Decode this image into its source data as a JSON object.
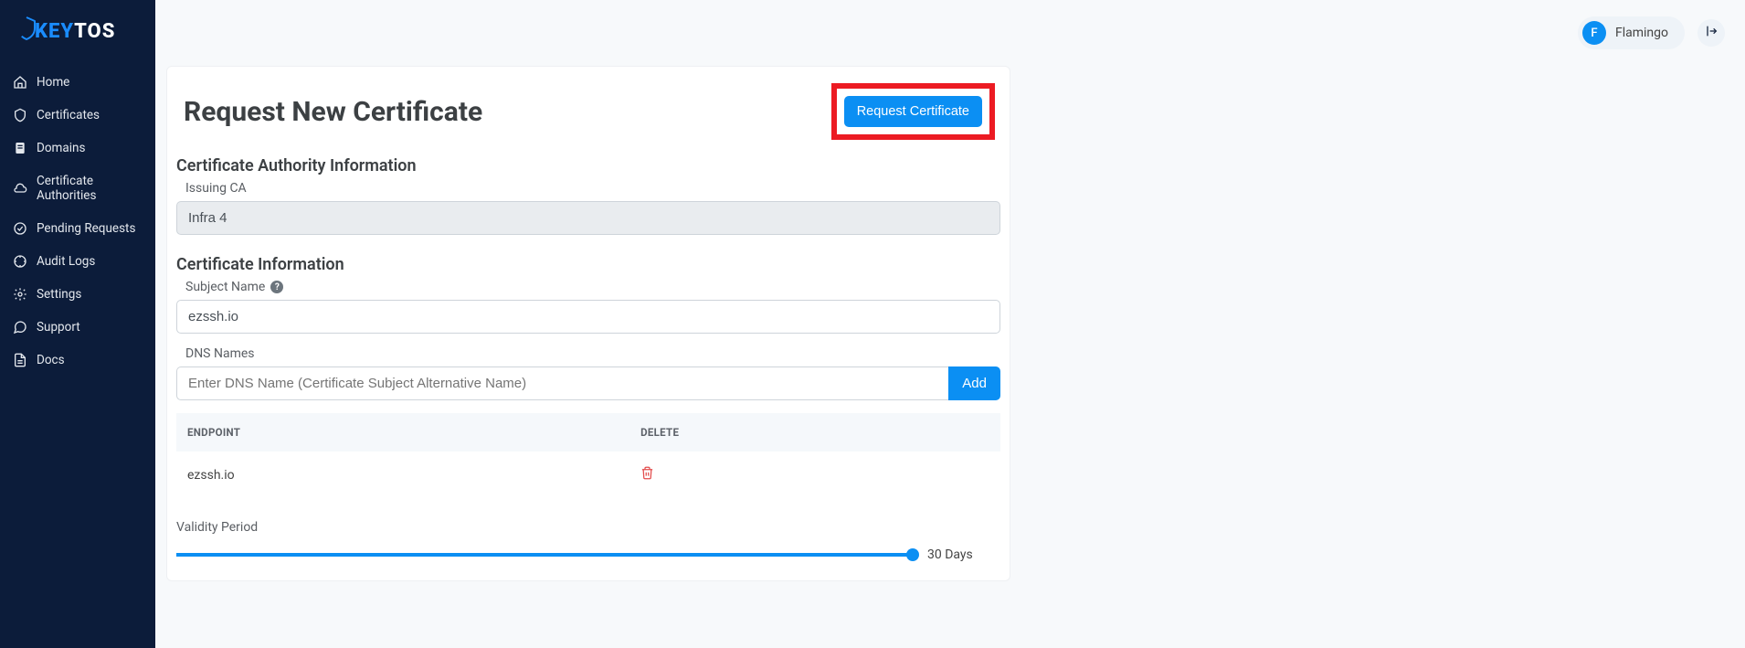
{
  "brand": {
    "text1": "KEY",
    "text2": "TOS"
  },
  "sidebar": {
    "items": [
      {
        "label": "Home",
        "icon": "home"
      },
      {
        "label": "Certificates",
        "icon": "shield"
      },
      {
        "label": "Domains",
        "icon": "doc"
      },
      {
        "label": "Certificate Authorities",
        "icon": "cloud"
      },
      {
        "label": "Pending Requests",
        "icon": "clock"
      },
      {
        "label": "Audit Logs",
        "icon": "target"
      },
      {
        "label": "Settings",
        "icon": "gear"
      },
      {
        "label": "Support",
        "icon": "chat"
      },
      {
        "label": "Docs",
        "icon": "page"
      }
    ]
  },
  "topbar": {
    "user_initial": "F",
    "user_name": "Flamingo"
  },
  "page": {
    "title": "Request New Certificate",
    "request_btn": "Request Certificate"
  },
  "ca_section": {
    "title": "Certificate Authority Information",
    "issuing_ca_label": "Issuing CA",
    "issuing_ca_value": "Infra 4"
  },
  "cert_section": {
    "title": "Certificate Information",
    "subject_name_label": "Subject Name",
    "subject_name_value": "ezssh.io",
    "dns_names_label": "DNS Names",
    "dns_placeholder": "Enter DNS Name (Certificate Subject Alternative Name)",
    "add_btn": "Add",
    "table": {
      "col_endpoint": "ENDPOINT",
      "col_delete": "DELETE",
      "rows": [
        {
          "endpoint": "ezssh.io"
        }
      ]
    },
    "validity_label": "Validity Period",
    "validity_value": "30 Days"
  }
}
